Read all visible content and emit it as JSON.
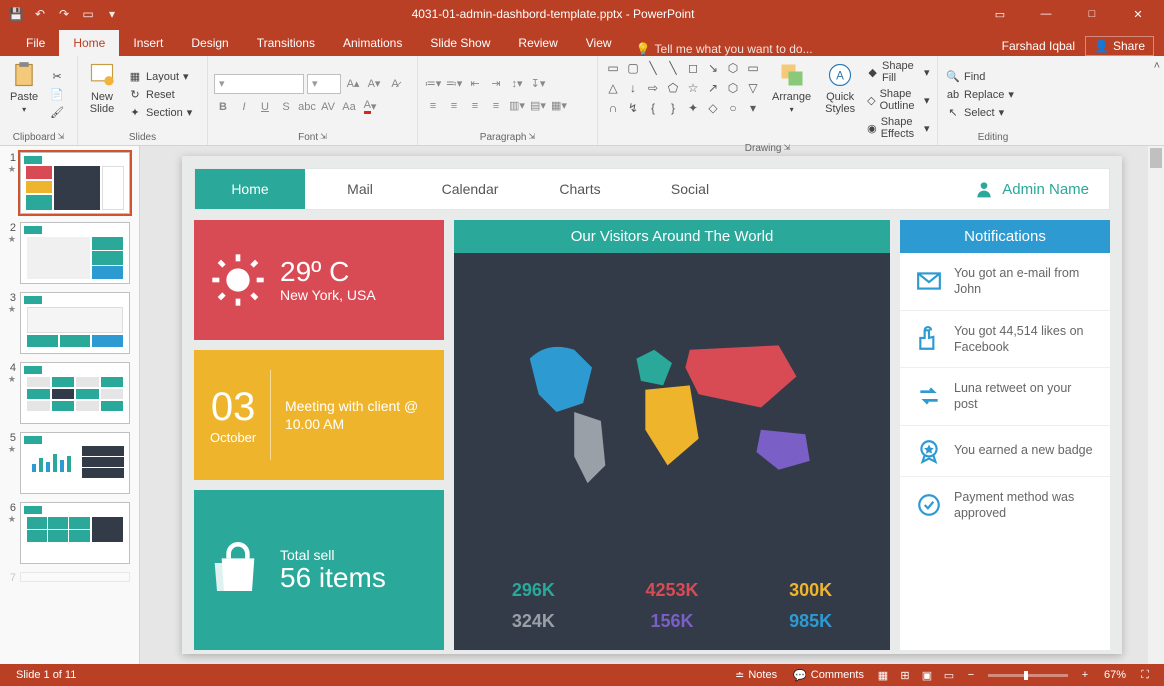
{
  "app": {
    "title": "4031-01-admin-dashbord-template.pptx - PowerPoint",
    "user": "Farshad Iqbal",
    "share": "Share"
  },
  "tabs": {
    "file": "File",
    "home": "Home",
    "insert": "Insert",
    "design": "Design",
    "transitions": "Transitions",
    "animations": "Animations",
    "slideshow": "Slide Show",
    "review": "Review",
    "view": "View",
    "tellme": "Tell me what you want to do..."
  },
  "ribbon": {
    "clipboard": {
      "label": "Clipboard",
      "paste": "Paste"
    },
    "slides": {
      "label": "Slides",
      "newslide": "New\nSlide",
      "layout": "Layout",
      "reset": "Reset",
      "section": "Section"
    },
    "font": {
      "label": "Font"
    },
    "paragraph": {
      "label": "Paragraph"
    },
    "drawing": {
      "label": "Drawing",
      "arrange": "Arrange",
      "quickstyles": "Quick\nStyles",
      "shapefill": "Shape Fill",
      "shapeoutline": "Shape Outline",
      "shapeeffects": "Shape Effects"
    },
    "editing": {
      "label": "Editing",
      "find": "Find",
      "replace": "Replace",
      "select": "Select"
    }
  },
  "slide": {
    "nav": {
      "home": "Home",
      "mail": "Mail",
      "calendar": "Calendar",
      "charts": "Charts",
      "social": "Social",
      "admin": "Admin Name"
    },
    "weather": {
      "temp": "29º C",
      "city": "New York, USA"
    },
    "meeting": {
      "day": "03",
      "month": "October",
      "text": "Meeting with client @ 10.00 AM"
    },
    "sell": {
      "label": "Total sell",
      "value": "56 items"
    },
    "visitors_title": "Our Visitors Around The World",
    "stats": [
      {
        "v": "296K",
        "c": "#2aa89a"
      },
      {
        "v": "4253K",
        "c": "#d84b55"
      },
      {
        "v": "300K",
        "c": "#eeb52c"
      },
      {
        "v": "324K",
        "c": "#9aa0a8"
      },
      {
        "v": "156K",
        "c": "#7a5fc7"
      },
      {
        "v": "985K",
        "c": "#2d9bd2"
      }
    ],
    "notifications_title": "Notifications",
    "notifications": [
      "You got an e-mail from John",
      "You got 44,514 likes on Facebook",
      "Luna retweet on your post",
      "You earned a new badge",
      "Payment method was approved"
    ]
  },
  "statusbar": {
    "slide": "Slide 1 of 11",
    "notes": "Notes",
    "comments": "Comments",
    "zoom": "67%"
  },
  "thumbs": [
    1,
    2,
    3,
    4,
    5,
    6
  ]
}
